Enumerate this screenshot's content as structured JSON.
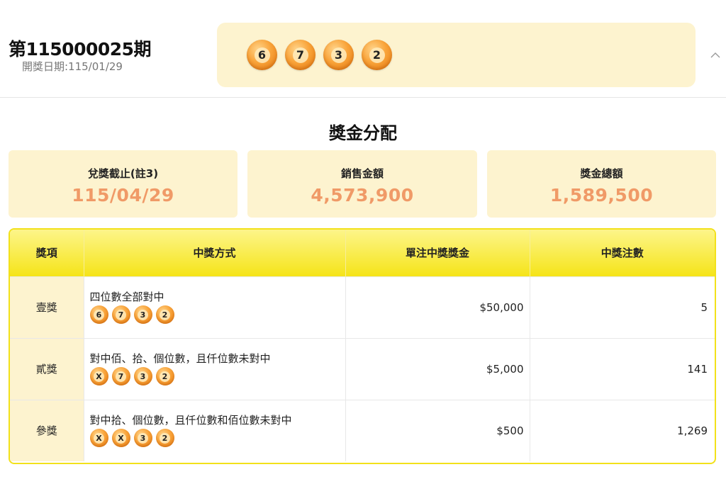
{
  "draw": {
    "period": "第115000025期",
    "date_label": "開獎日期:115/01/29",
    "numbers": [
      "6",
      "7",
      "3",
      "2"
    ]
  },
  "section_title": "獎金分配",
  "stats": [
    {
      "label": "兌獎截止(註3)",
      "value": "115/04/29"
    },
    {
      "label": "銷售金額",
      "value": "4,573,900"
    },
    {
      "label": "獎金總額",
      "value": "1,589,500"
    }
  ],
  "table": {
    "headers": [
      "獎項",
      "中獎方式",
      "單注中獎獎金",
      "中獎注數"
    ],
    "rows": [
      {
        "prize": "壹獎",
        "method": "四位數全部對中",
        "balls": [
          "6",
          "7",
          "3",
          "2"
        ],
        "amount": "$50,000",
        "count": "5"
      },
      {
        "prize": "貳獎",
        "method": "對中佰、拾、個位數，且仟位數未對中",
        "balls": [
          "X",
          "7",
          "3",
          "2"
        ],
        "amount": "$5,000",
        "count": "141"
      },
      {
        "prize": "參獎",
        "method": "對中拾、個位數，且仟位數和佰位數未對中",
        "balls": [
          "X",
          "X",
          "3",
          "2"
        ],
        "amount": "$500",
        "count": "1,269"
      }
    ]
  },
  "icons": {
    "collapse": "chevron-up-icon",
    "ball": "lottery-ball-icon"
  },
  "colors": {
    "panel_bg": "#fdf3cf",
    "stat_value": "#f09a67",
    "table_header": "#f5e418",
    "ball": "#f9a43a"
  }
}
